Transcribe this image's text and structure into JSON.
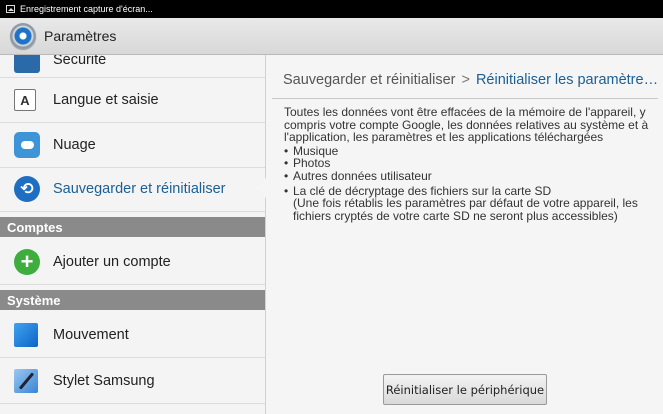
{
  "status_bar": {
    "notification_text": "Enregistrement capture d'écran..."
  },
  "action_bar": {
    "title": "Paramètres"
  },
  "sidebar": {
    "items": [
      {
        "label": "Sécurité"
      },
      {
        "label": "Langue et saisie",
        "icon_letter": "A"
      },
      {
        "label": "Nuage"
      },
      {
        "label": "Sauvegarder et réinitialiser",
        "selected": true
      },
      {
        "label": "Ajouter un compte"
      },
      {
        "label": "Mouvement"
      },
      {
        "label": "Stylet Samsung"
      }
    ],
    "categories": {
      "accounts": "Comptes",
      "system": "Système"
    }
  },
  "detail": {
    "breadcrumb_parent": "Sauvegarder et réinitialiser",
    "breadcrumb_separator": ">",
    "breadcrumb_current": "Réinitialiser les paramètres par défaut",
    "intro": "Toutes les données vont être effacées de la mémoire de l'appareil, y compris votre compte Google, les données relatives au système et à l'application, les paramètres et les applications téléchargées",
    "bullets": [
      "Musique",
      "Photos",
      "Autres données utilisateur"
    ],
    "sd_bullet": "La clé de décryptage des fichiers sur la carte SD",
    "sd_note": "(Une fois rétablis les paramètres par défaut de votre appareil, les fichiers cryptés de votre carte SD ne seront plus accessibles)",
    "reset_button": "Réinitialiser le périphérique"
  },
  "colors": {
    "accent": "#1b5f95",
    "category_bg": "#8a8a8a",
    "status_bar": "#000000"
  }
}
